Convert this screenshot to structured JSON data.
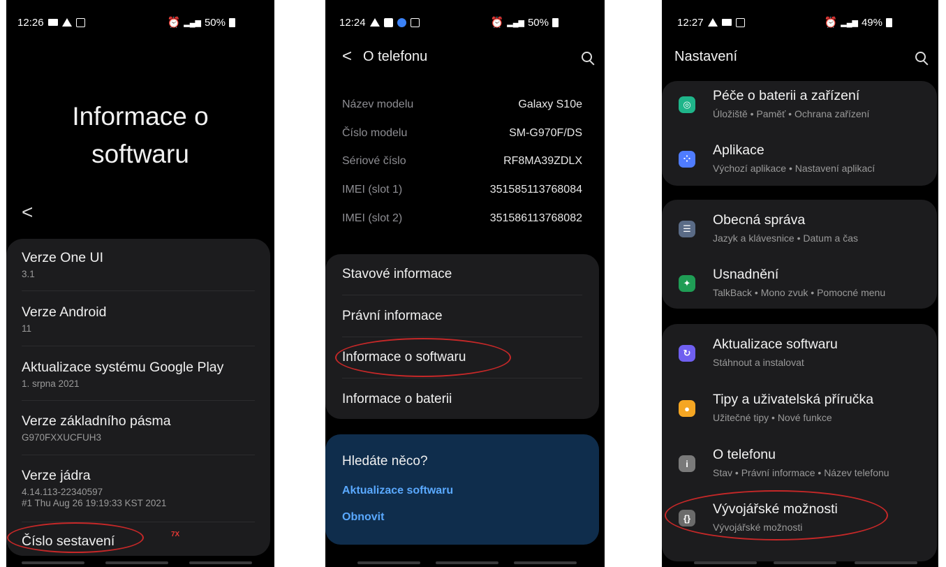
{
  "phone1": {
    "status": {
      "time": "12:26",
      "battery": "50%"
    },
    "title_line1": "Informace o",
    "title_line2": "softwaru",
    "rows": [
      {
        "title": "Verze One UI",
        "sub": "3.1"
      },
      {
        "title": "Verze Android",
        "sub": "11"
      },
      {
        "title": "Aktualizace systému Google Play",
        "sub": "1. srpna 2021"
      },
      {
        "title": "Verze základního pásma",
        "sub": "G970FXXUCFUH3"
      },
      {
        "title": "Verze jádra",
        "sub": "4.14.113-22340597",
        "sub2": "#1 Thu Aug 26 19:19:33 KST 2021"
      },
      {
        "title": "Číslo sestavení"
      }
    ],
    "annotation": "7X"
  },
  "phone2": {
    "status": {
      "time": "12:24",
      "battery": "50%"
    },
    "title": "O telefonu",
    "specs": [
      {
        "label": "Název modelu",
        "value": "Galaxy S10e"
      },
      {
        "label": "Číslo modelu",
        "value": "SM-G970F/DS"
      },
      {
        "label": "Sériové číslo",
        "value": "RF8MA39ZDLX"
      },
      {
        "label": "IMEI (slot 1)",
        "value": "351585113768084"
      },
      {
        "label": "IMEI (slot 2)",
        "value": "351586113768082"
      }
    ],
    "menu": [
      "Stavové informace",
      "Právní informace",
      "Informace o softwaru",
      "Informace o baterii"
    ],
    "looking": {
      "title": "Hledáte něco?",
      "links": [
        "Aktualizace softwaru",
        "Obnovit"
      ]
    }
  },
  "phone3": {
    "status": {
      "time": "12:27",
      "battery": "49%"
    },
    "title": "Nastavení",
    "items": [
      {
        "title": "Péče o baterii a zařízení",
        "sub": "Úložiště • Paměť • Ochrana zařízení",
        "icon": "device-care-icon",
        "color": "#1fb58a"
      },
      {
        "title": "Aplikace",
        "sub": "Výchozí aplikace • Nastavení aplikací",
        "icon": "apps-icon",
        "color": "#4f7cff"
      },
      {
        "title": "Obecná správa",
        "sub": "Jazyk a klávesnice • Datum a čas",
        "icon": "general-management-icon",
        "color": "#5a6b86"
      },
      {
        "title": "Usnadnění",
        "sub": "TalkBack • Mono zvuk • Pomocné menu",
        "icon": "accessibility-icon",
        "color": "#1f9d55"
      },
      {
        "title": "Aktualizace softwaru",
        "sub": "Stáhnout a instalovat",
        "icon": "software-update-icon",
        "color": "#6f5ff0"
      },
      {
        "title": "Tipy a uživatelská příručka",
        "sub": "Užitečné tipy • Nové funkce",
        "icon": "tips-icon",
        "color": "#f5a623"
      },
      {
        "title": "O telefonu",
        "sub": "Stav • Právní informace • Název telefonu",
        "icon": "about-phone-icon",
        "color": "#7a7a7a"
      },
      {
        "title": "Vývojářské možnosti",
        "sub": "Vývojářské možnosti",
        "icon": "developer-options-icon",
        "color": "#6b6b6b"
      }
    ]
  }
}
